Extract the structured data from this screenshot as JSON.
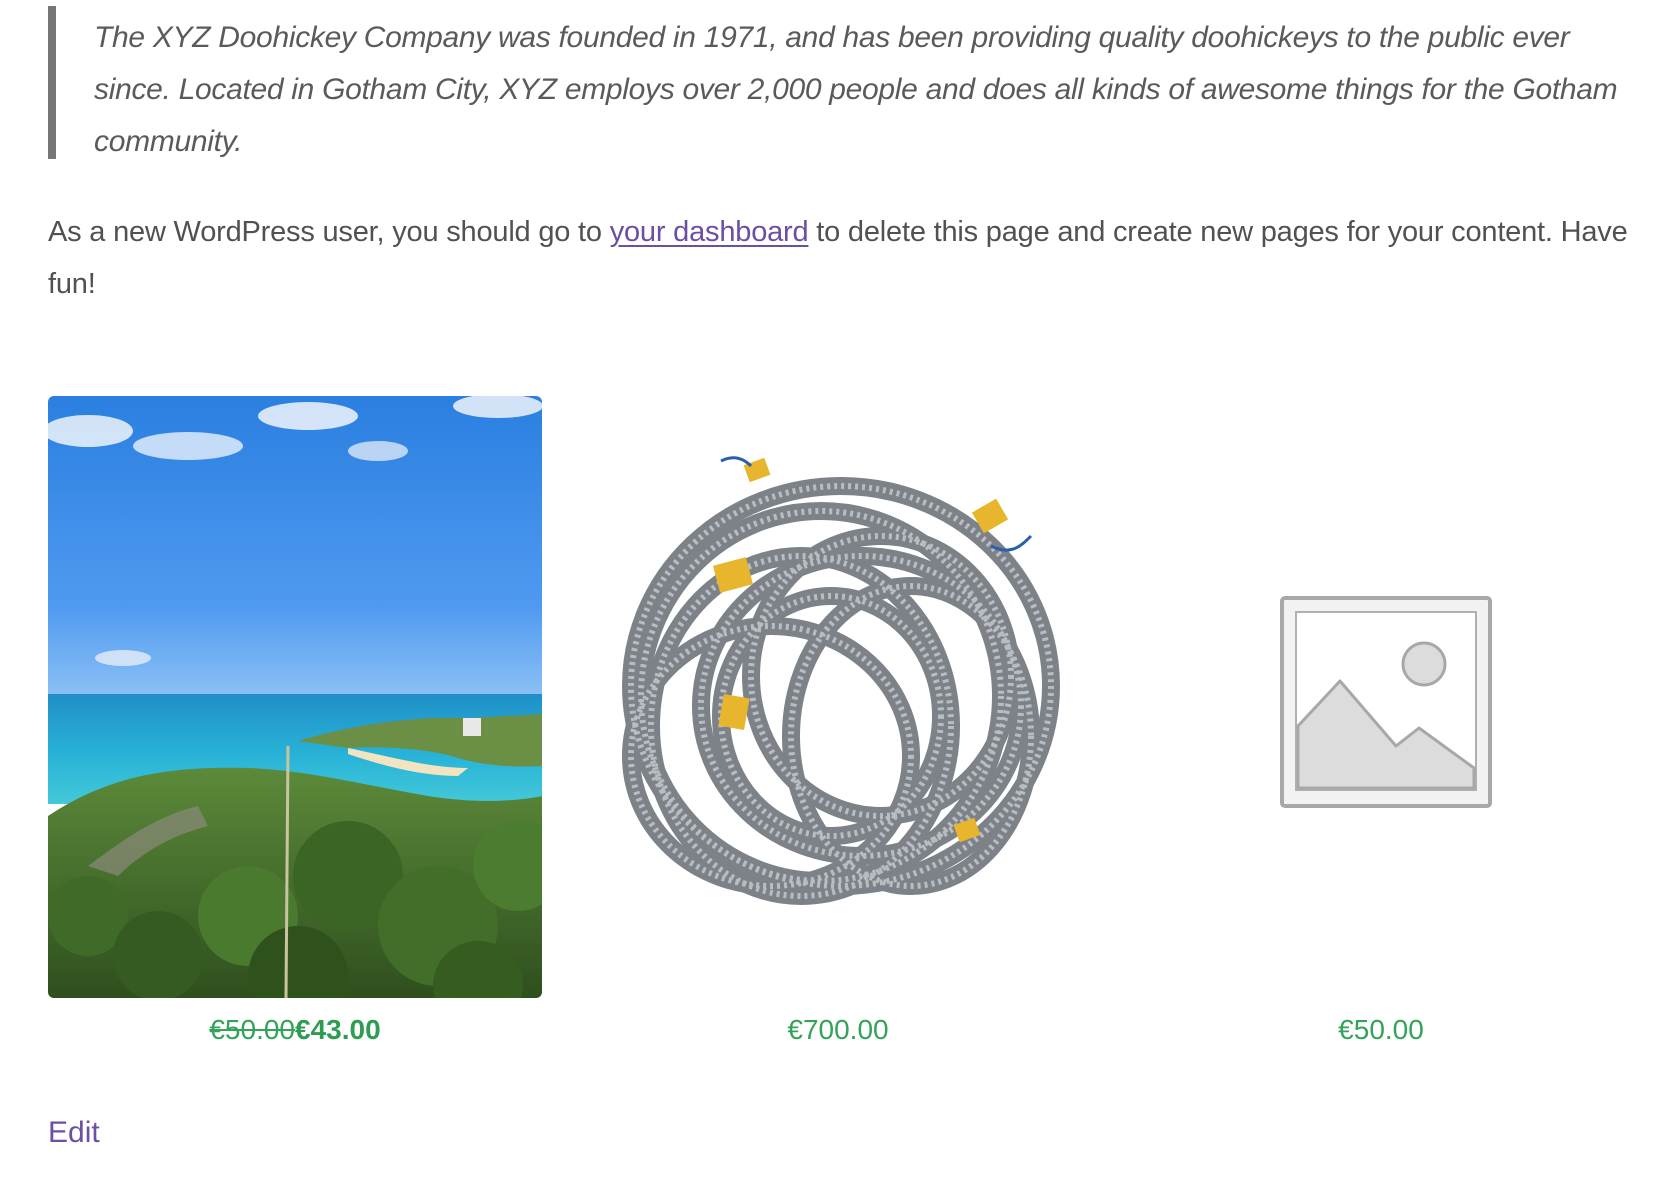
{
  "quote": {
    "text": "The XYZ Doohickey Company was founded in 1971, and has been providing quality doohickeys to the public ever since. Located in Gotham City, XYZ employs over 2,000 people and does all kinds of awesome things for the Gotham community."
  },
  "intro": {
    "before_link": "As a new WordPress user, you should go to ",
    "link_text": "your dashboard",
    "after_link": " to delete this page and create new pages for your content. Have fun!"
  },
  "products": [
    {
      "image": "coastal-landscape-photo",
      "regular_price": "€50.00",
      "sale_price": "€43.00"
    },
    {
      "image": "coiled-metal-conduit-photo",
      "price": "€700.00"
    },
    {
      "image": "placeholder-image-icon",
      "price": "€50.00"
    }
  ],
  "edit": {
    "label": "Edit"
  },
  "colors": {
    "price_green": "#33a35a",
    "link_purple": "#6b4fa2",
    "quote_border": "#767676"
  }
}
